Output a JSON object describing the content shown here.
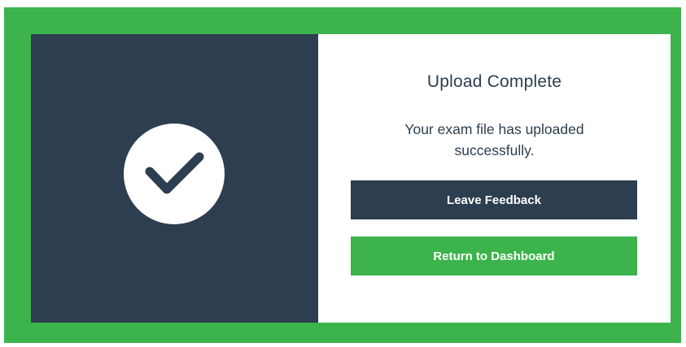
{
  "dialog": {
    "title": "Upload Complete",
    "message": "Your exam file has uploaded successfully.",
    "icon": "checkmark-icon"
  },
  "buttons": {
    "leave_feedback": "Leave Feedback",
    "return_dashboard": "Return to Dashboard"
  },
  "colors": {
    "frame_green": "#3cb44b",
    "panel_navy": "#2c3e4f",
    "button_green": "#3cb44b",
    "background": "#ffffff"
  }
}
